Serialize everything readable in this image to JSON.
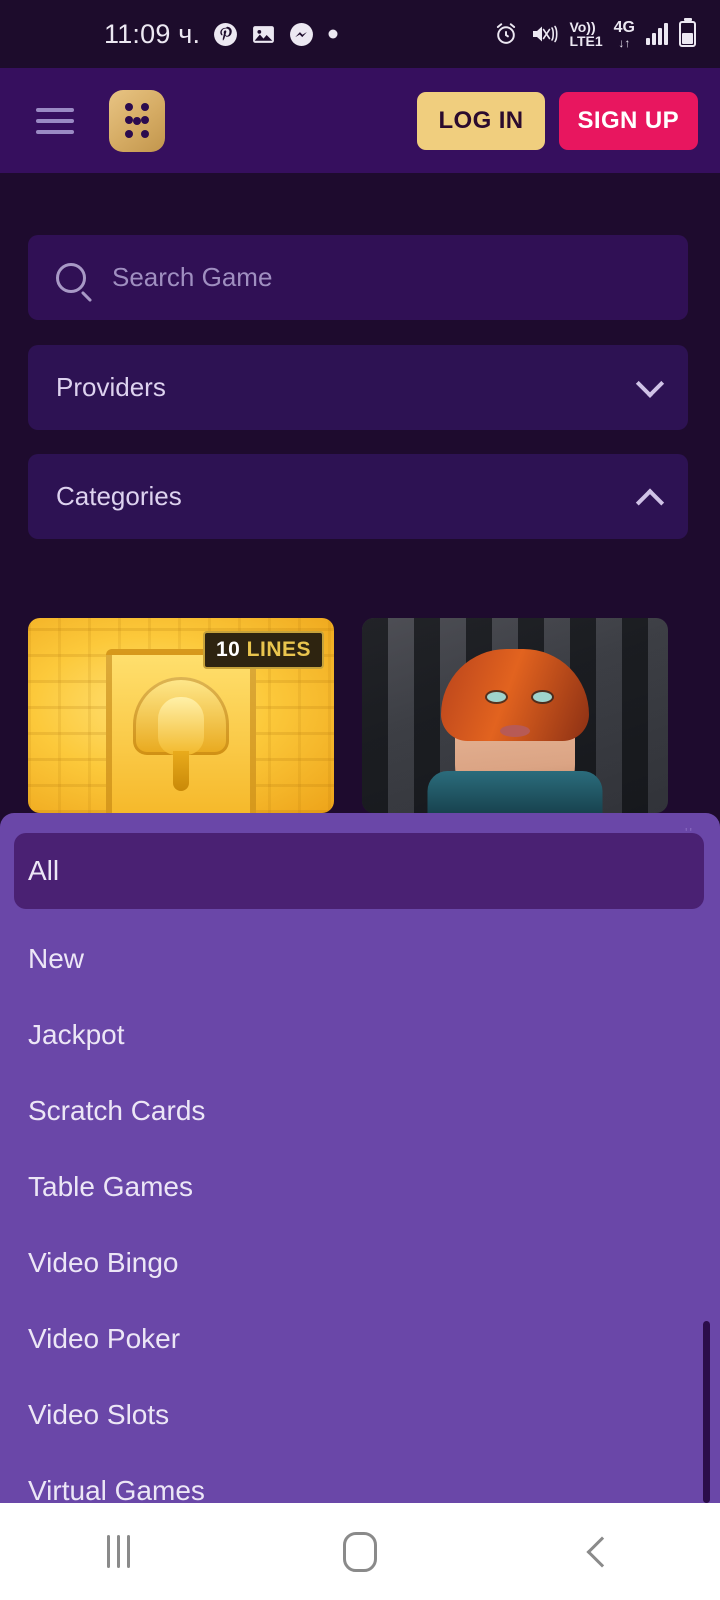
{
  "status_bar": {
    "time": "11:09 ч.",
    "left_icons": [
      "pinterest-icon",
      "gallery-icon",
      "messenger-icon",
      "dot-icon"
    ],
    "right_icons": [
      "alarm-icon",
      "mute-vibrate-icon",
      "signal-bars-icon",
      "battery-icon"
    ],
    "volte_line1": "Vo))",
    "volte_line2": "LTE1",
    "network": "4G",
    "data_arrows": "↓↑"
  },
  "header": {
    "menu_icon": "hamburger-menu-icon",
    "logo_icon": "dice-logo-icon",
    "login_label": "LOG IN",
    "signup_label": "SIGN UP",
    "colors": {
      "header_bg": "#360F5E",
      "login_bg": "#F0CE7E",
      "signup_bg": "#E8165F"
    }
  },
  "search": {
    "placeholder": "Search Game",
    "value": "",
    "icon": "search-icon"
  },
  "filters": [
    {
      "label": "Providers",
      "state": "collapsed",
      "chevron": "chevron-down-icon"
    },
    {
      "label": "Categories",
      "state": "expanded",
      "chevron": "chevron-up-icon"
    }
  ],
  "games": [
    {
      "name": "egypt-pharaoh-slot",
      "badge_num": "10",
      "badge_word": "LINES"
    },
    {
      "name": "adventure-woman-slot",
      "badge_num": "",
      "badge_word": ""
    }
  ],
  "categories_dropdown": {
    "corner_artifact": "''",
    "selected": "All",
    "items": [
      {
        "label": "All",
        "selected": true
      },
      {
        "label": "New",
        "selected": false
      },
      {
        "label": "Jackpot",
        "selected": false
      },
      {
        "label": "Scratch Cards",
        "selected": false
      },
      {
        "label": "Table Games",
        "selected": false
      },
      {
        "label": "Video Bingo",
        "selected": false
      },
      {
        "label": "Video Poker",
        "selected": false
      },
      {
        "label": "Video Slots",
        "selected": false
      },
      {
        "label": "Virtual Games",
        "selected": false
      }
    ],
    "colors": {
      "panel_bg": "#6A47A8",
      "selected_bg": "#4A2173",
      "scrollbar": "#2B0D4A"
    }
  },
  "navbar": {
    "recents": "recents-icon",
    "home": "home-icon",
    "back": "back-icon"
  },
  "theme": {
    "page_bg": "#1E0B2E",
    "search_bg": "#301055",
    "accordion_bg": "#2D1253"
  }
}
